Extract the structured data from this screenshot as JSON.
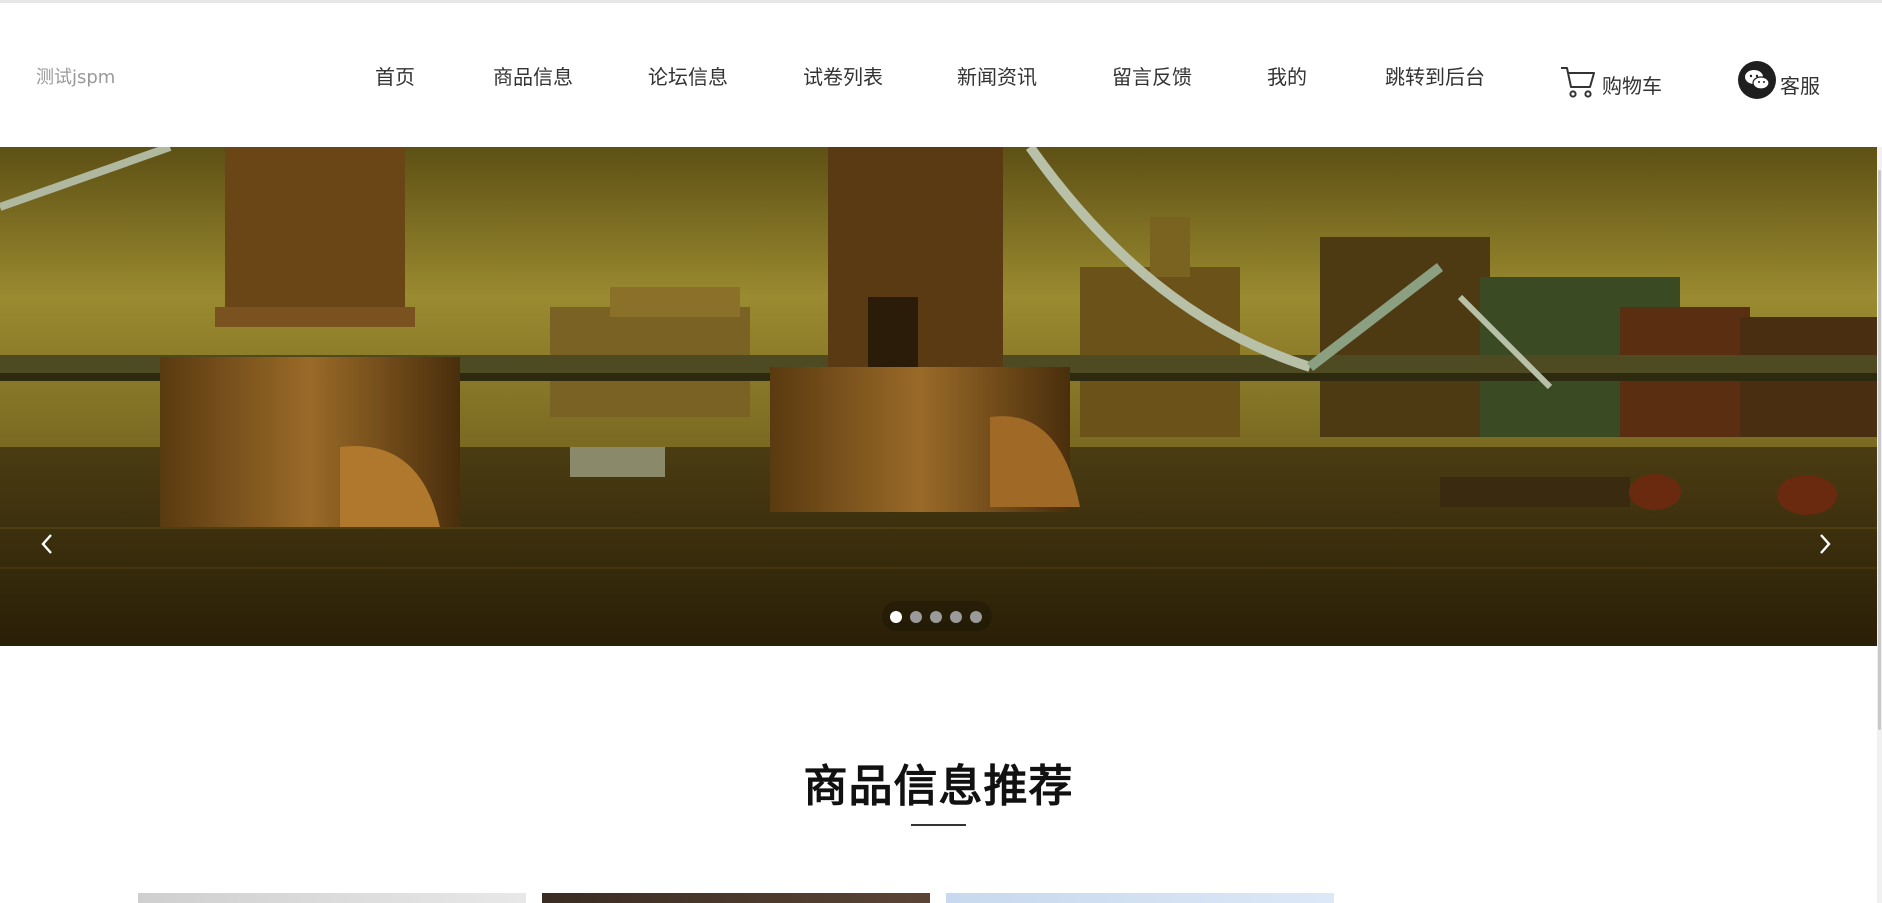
{
  "header": {
    "logo": "测试jspm",
    "nav": [
      {
        "label": "首页"
      },
      {
        "label": "商品信息"
      },
      {
        "label": "论坛信息"
      },
      {
        "label": "试卷列表"
      },
      {
        "label": "新闻资讯"
      },
      {
        "label": "留言反馈"
      },
      {
        "label": "我的"
      },
      {
        "label": "跳转到后台"
      }
    ],
    "cart_label": "购物车",
    "cs_label": "客服"
  },
  "banner": {
    "slide_count": 5,
    "active_slide": 1,
    "prev_icon": "chevron-left-icon",
    "next_icon": "chevron-right-icon"
  },
  "section": {
    "title": "商品信息推荐"
  },
  "colors": {
    "divider": "#333333",
    "logo_text": "#9a9a9a",
    "dot_active": "#ffffff",
    "dot_inactive": "#9a9a9a"
  }
}
